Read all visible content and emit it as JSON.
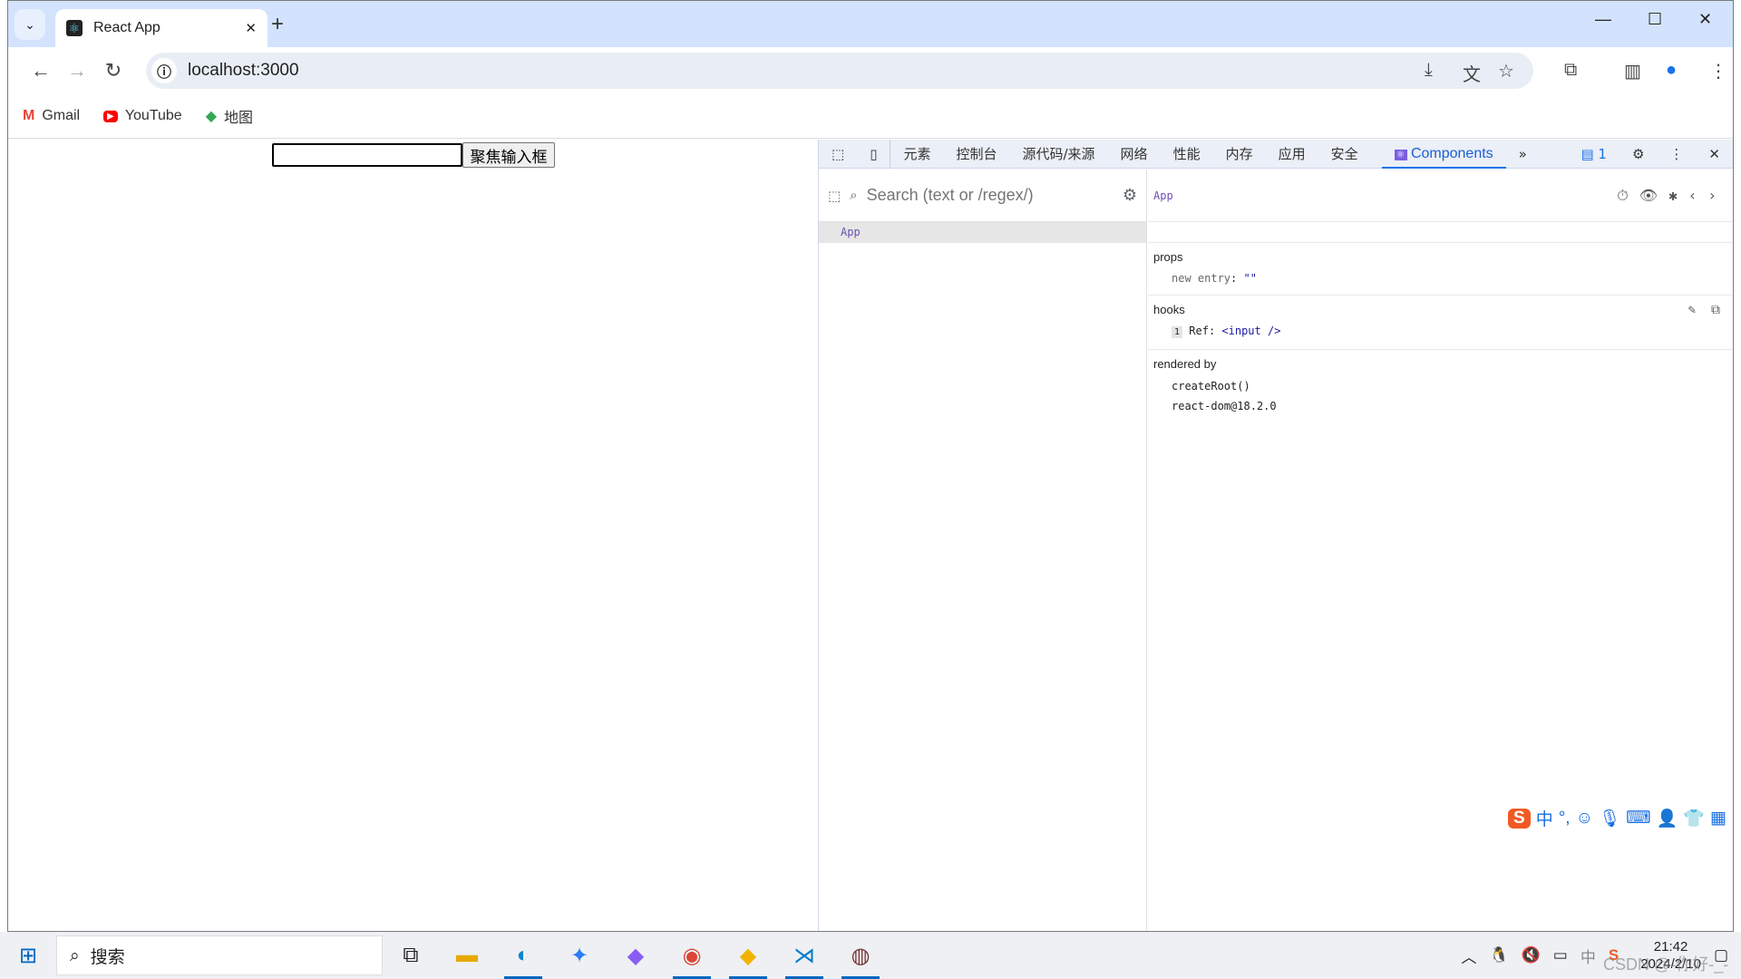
{
  "browser": {
    "tab_title": "React App",
    "url": "localhost:3000",
    "bookmarks": [
      {
        "label": "Gmail",
        "icon": "gmail-icon",
        "color": "#ea4335"
      },
      {
        "label": "YouTube",
        "icon": "youtube-icon",
        "color": "#ff0000"
      },
      {
        "label": "地图",
        "icon": "maps-icon",
        "color": "#34a853"
      }
    ]
  },
  "page": {
    "input_value": "",
    "button_label": "聚焦输入框"
  },
  "devtools": {
    "tabs": [
      "元素",
      "控制台",
      "源代码/来源",
      "网络",
      "性能",
      "内存",
      "应用",
      "安全",
      "Components"
    ],
    "active_tab": "Components",
    "issues_count": "1",
    "search_placeholder": "Search (text or /regex/)",
    "tree_items": [
      "App"
    ],
    "selected_component": "App",
    "props_title": "props",
    "props": [
      {
        "key": "new entry",
        "value": "\"\""
      }
    ],
    "hooks_title": "hooks",
    "hooks": [
      {
        "index": "1",
        "key": "Ref",
        "value": "<input />"
      }
    ],
    "rendered_by_title": "rendered by",
    "rendered_by": [
      "createRoot()",
      "react-dom@18.2.0"
    ]
  },
  "taskbar": {
    "search_label": "搜索",
    "time": "21:42",
    "date": "2024/2/10",
    "ime_lang": "中"
  },
  "watermark": "CSDN @-你好-_-",
  "colors": {
    "accent": "#1a73e8",
    "component_name": "#6c4fb4"
  }
}
